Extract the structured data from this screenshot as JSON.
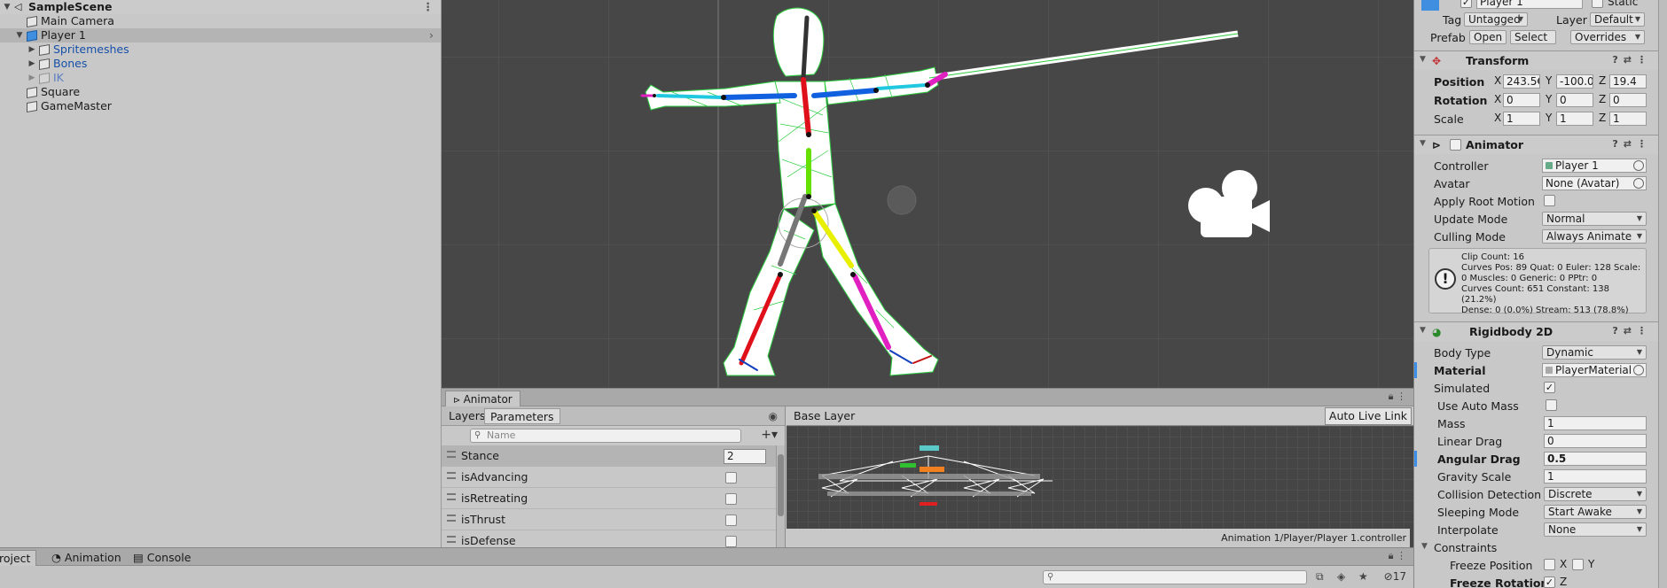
{
  "hierarchy": {
    "scene_name": "SampleScene",
    "items": [
      {
        "label": "Main Camera"
      },
      {
        "label": "Player 1"
      },
      {
        "label": "Spritemeshes"
      },
      {
        "label": "Bones"
      },
      {
        "label": "IK"
      },
      {
        "label": "Square"
      },
      {
        "label": "GameMaster"
      }
    ]
  },
  "animator": {
    "tab_label": "Animator",
    "layers_tab": "Layers",
    "parameters_tab": "Parameters",
    "search_placeholder": "Name",
    "parameters": [
      {
        "name": "Stance",
        "value": "2"
      },
      {
        "name": "isAdvancing"
      },
      {
        "name": "isRetreating"
      },
      {
        "name": "isThrust"
      },
      {
        "name": "isDefense"
      }
    ],
    "breadcrumb": "Base Layer",
    "auto_live_link": "Auto Live Link",
    "controller_path": "Animation 1/Player/Player 1.controller"
  },
  "bottom": {
    "tabs": [
      "roject",
      "Animation",
      "Console"
    ],
    "hidden_count": "17"
  },
  "inspector": {
    "name_field": "Player 1",
    "static_label": "Static",
    "tag_label": "Tag",
    "tag_value": "Untagged",
    "layer_label": "Layer",
    "layer_value": "Default",
    "prefab_label": "Prefab",
    "prefab_open": "Open",
    "prefab_select": "Select",
    "prefab_overrides": "Overrides",
    "transform": {
      "title": "Transform",
      "position_label": "Position",
      "rotation_label": "Rotation",
      "scale_label": "Scale",
      "position": {
        "x": "243.5€",
        "y": "-100.0",
        "z": "19.4"
      },
      "rotation": {
        "x": "0",
        "y": "0",
        "z": "0"
      },
      "scale": {
        "x": "1",
        "y": "1",
        "z": "1"
      },
      "axis_x": "X",
      "axis_y": "Y",
      "axis_z": "Z"
    },
    "animator": {
      "title": "Animator",
      "controller_label": "Controller",
      "controller_value": "Player 1",
      "avatar_label": "Avatar",
      "avatar_value": "None (Avatar)",
      "apply_root_label": "Apply Root Motion",
      "update_mode_label": "Update Mode",
      "update_mode_value": "Normal",
      "culling_label": "Culling Mode",
      "culling_value": "Always Animate",
      "info_lines": [
        "Clip Count: 16",
        "Curves Pos: 89 Quat: 0 Euler: 128 Scale:",
        "0 Muscles: 0 Generic: 0 PPtr: 0",
        "Curves Count: 651 Constant: 138 (21.2%)",
        "Dense: 0 (0.0%) Stream: 513 (78.8%)"
      ]
    },
    "rigidbody": {
      "title": "Rigidbody 2D",
      "body_type_label": "Body Type",
      "body_type_value": "Dynamic",
      "material_label": "Material",
      "material_value": "PlayerMaterial",
      "simulated_label": "Simulated",
      "auto_mass_label": "Use Auto Mass",
      "mass_label": "Mass",
      "mass_value": "1",
      "linear_drag_label": "Linear Drag",
      "linear_drag_value": "0",
      "angular_drag_label": "Angular Drag",
      "angular_drag_value": "0.5",
      "gravity_label": "Gravity Scale",
      "gravity_value": "1",
      "collision_label": "Collision Detection",
      "collision_value": "Discrete",
      "sleeping_label": "Sleeping Mode",
      "sleeping_value": "Start Awake",
      "interpolate_label": "Interpolate",
      "interpolate_value": "None",
      "constraints_label": "Constraints",
      "freeze_pos_label": "Freeze Position",
      "freeze_rot_label": "Freeze Rotation",
      "axis_x": "X",
      "axis_y": "Y",
      "axis_z": "Z"
    }
  },
  "colors": {
    "scene_bg": "#474747",
    "selection_blue": "#3b8ee8",
    "panel": "#c8c8c8"
  }
}
